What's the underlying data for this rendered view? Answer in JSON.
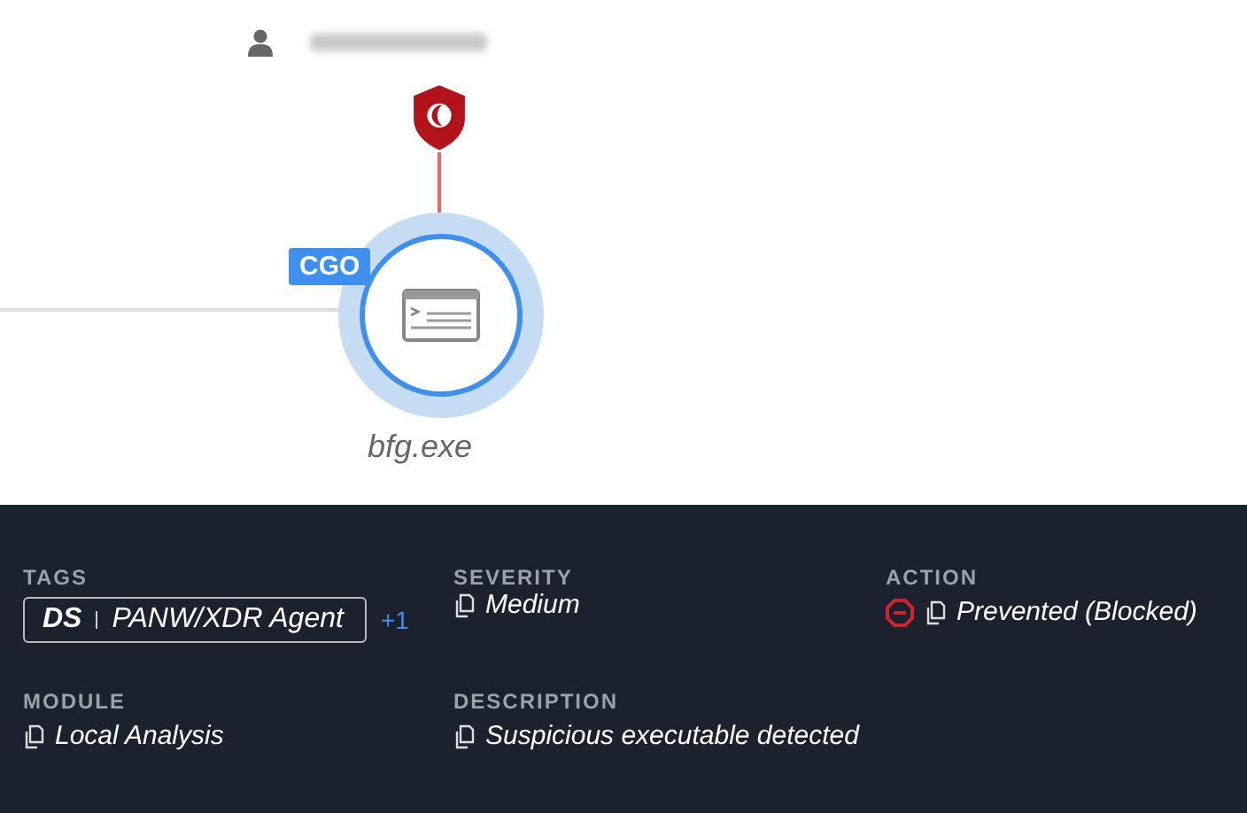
{
  "graph": {
    "process": {
      "name": "bfg.exe",
      "badge": "CGO"
    }
  },
  "details": [
    {
      "label": "TAGS",
      "kind": "tags",
      "tag": {
        "prefix": "DS",
        "value": "PANW/XDR Agent"
      },
      "more": "+1"
    },
    {
      "label": "SEVERITY",
      "kind": "text",
      "value": "Medium"
    },
    {
      "label": "ACTION",
      "kind": "action",
      "value": "Prevented (Blocked)"
    },
    {
      "label": "MODULE",
      "kind": "text",
      "value": "Local Analysis"
    },
    {
      "label": "DESCRIPTION",
      "kind": "text",
      "value": "Suspicious executable detected"
    }
  ]
}
